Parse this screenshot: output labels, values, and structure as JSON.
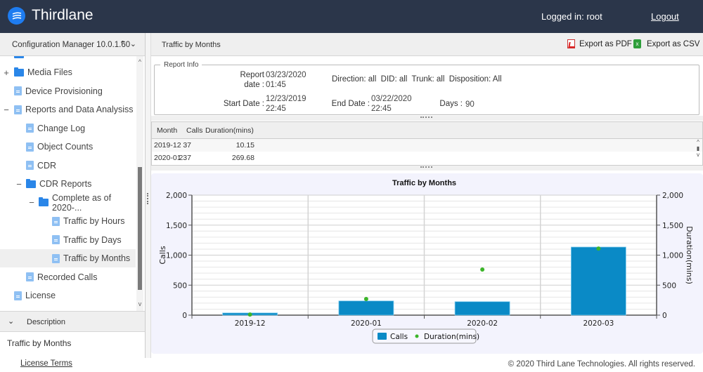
{
  "topbar": {
    "brand": "Thirdlane",
    "logged_in": "Logged in: root",
    "logout": "Logout"
  },
  "sidebar": {
    "header": "Configuration Manager 10.0.1.60",
    "items": [
      {
        "label": "Media Files",
        "type": "folder",
        "toggle": "+",
        "level": 0
      },
      {
        "label": "Device Provisioning",
        "type": "file",
        "toggle": "",
        "level": 0
      },
      {
        "label": "Reports and Data Analysiss",
        "type": "file",
        "toggle": "−",
        "level": 0
      },
      {
        "label": "Change Log",
        "type": "file",
        "toggle": "",
        "level": 1
      },
      {
        "label": "Object Counts",
        "type": "file",
        "toggle": "",
        "level": 1
      },
      {
        "label": "CDR",
        "type": "file",
        "toggle": "",
        "level": 1
      },
      {
        "label": "CDR Reports",
        "type": "folder",
        "toggle": "−",
        "level": 1
      },
      {
        "label": "Complete as of 2020-...",
        "type": "folder",
        "toggle": "−",
        "level": 2
      },
      {
        "label": "Traffic by Hours",
        "type": "file",
        "toggle": "",
        "level": 3
      },
      {
        "label": "Traffic by Days",
        "type": "file",
        "toggle": "",
        "level": 3
      },
      {
        "label": "Traffic by Months",
        "type": "file",
        "toggle": "",
        "level": 3,
        "selected": true
      },
      {
        "label": "Recorded Calls",
        "type": "file",
        "toggle": "",
        "level": 1
      },
      {
        "label": "License",
        "type": "file",
        "toggle": "",
        "level": 0
      }
    ],
    "description_header": "Description",
    "description_text": "Traffic by Months"
  },
  "main": {
    "title": "Traffic by Months",
    "export_pdf": "Export as PDF",
    "export_csv": "Export as CSV",
    "report_info": {
      "legend": "Report Info",
      "report_date_label_1": "Report",
      "report_date_label_2": "date :",
      "report_date_1": "03/23/2020",
      "report_date_2": "01:45",
      "filters": "Direction: all  DID: all  Trunk: all  Disposition: All",
      "start_label": "Start Date :",
      "start_1": "12/23/2019",
      "start_2": "22:45",
      "end_label": "End Date :",
      "end_1": "03/22/2020",
      "end_2": "22:45",
      "days_label": "Days :",
      "days": "90"
    },
    "table": {
      "columns": [
        "Month",
        "Calls",
        "Duration(mins)"
      ],
      "rows": [
        [
          "2019-12",
          "37",
          "10.15"
        ],
        [
          "2020-01",
          "237",
          "269.68"
        ]
      ]
    }
  },
  "chart_data": {
    "type": "bar",
    "title": "Traffic by Months",
    "categories": [
      "2019-12",
      "2020-01",
      "2020-02",
      "2020-03"
    ],
    "series": [
      {
        "name": "Calls",
        "type": "bar",
        "axis": "left",
        "color": "#0a8ac6",
        "values": [
          37,
          237,
          225,
          1135
        ]
      },
      {
        "name": "Duration(mins)",
        "type": "scatter",
        "axis": "right",
        "color": "#3cb52a",
        "values": [
          10.15,
          269.68,
          760,
          1110
        ]
      }
    ],
    "ylabel": "Calls",
    "y2label": "Duration(mins)",
    "ylim": [
      0,
      2000
    ],
    "y2lim": [
      0,
      2000
    ],
    "yticks": [
      "0",
      "500",
      "1,000",
      "1,500",
      "2,000"
    ],
    "ytick_values": [
      0,
      500,
      1000,
      1500,
      2000
    ],
    "grid": true,
    "legend": "bottom-center"
  },
  "footer": {
    "license": "License Terms",
    "copyright": "© 2020 Third Lane Technologies. All rights reserved."
  }
}
